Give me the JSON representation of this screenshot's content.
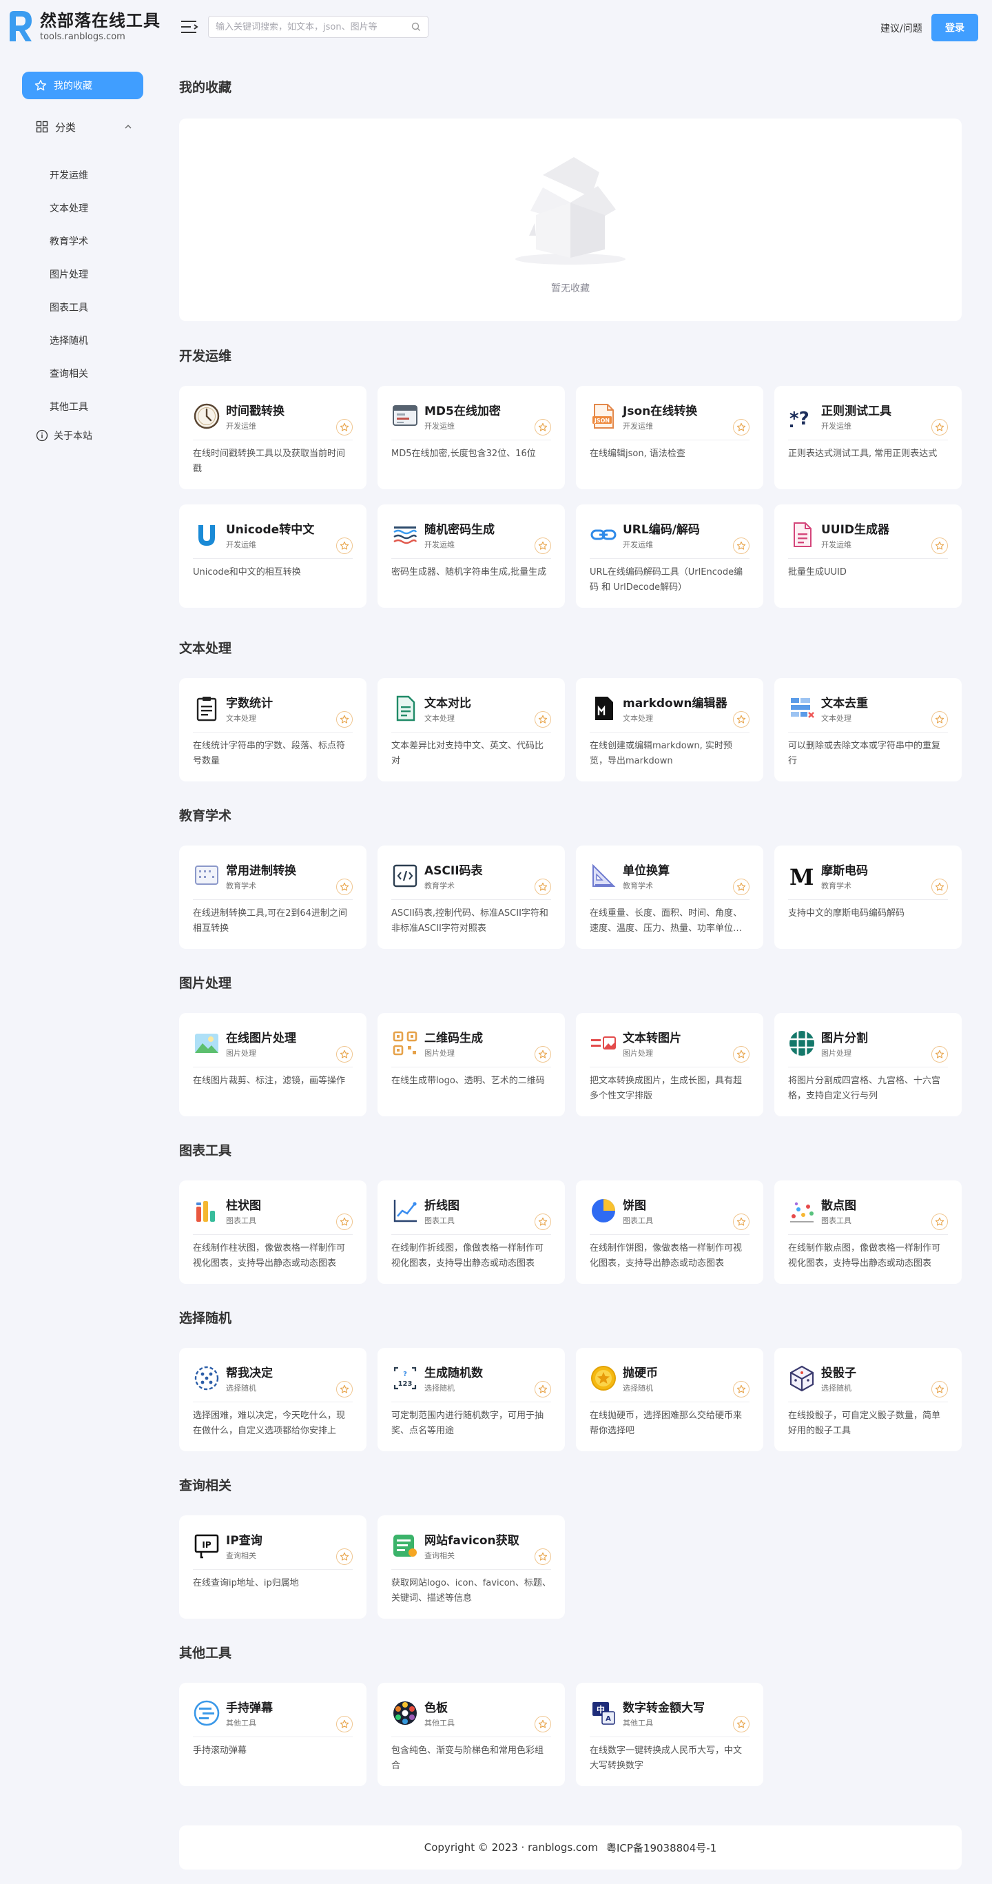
{
  "header": {
    "site_title": "然部落在线工具",
    "site_domain": "tools.ranblogs.com",
    "search_placeholder": "输入关键词搜索，如文本，json、图片等",
    "feedback_label": "建议/问题",
    "login_label": "登录"
  },
  "sidebar": {
    "favorites_label": "我的收藏",
    "category_label": "分类",
    "items": [
      "开发运维",
      "文本处理",
      "教育学术",
      "图片处理",
      "图表工具",
      "选择随机",
      "查询相关",
      "其他工具"
    ],
    "about_label": "关于本站"
  },
  "favorites": {
    "title": "我的收藏",
    "empty_text": "暂无收藏"
  },
  "sections": [
    {
      "title": "开发运维",
      "cards": [
        {
          "title": "时间戳转换",
          "cat": "开发运维",
          "desc": "在线时间戳转换工具以及获取当前时间戳",
          "icon": "clock-icon"
        },
        {
          "title": "MD5在线加密",
          "cat": "开发运维",
          "desc": "MD5在线加密,长度包含32位、16位",
          "icon": "md5-icon"
        },
        {
          "title": "Json在线转换",
          "cat": "开发运维",
          "desc": "在线编辑json, 语法检查",
          "icon": "json-file-icon"
        },
        {
          "title": "正则测试工具",
          "cat": "开发运维",
          "desc": "正则表达式测试工具, 常用正则表达式",
          "icon": "regex-icon"
        },
        {
          "title": "Unicode转中文",
          "cat": "开发运维",
          "desc": "Unicode和中文的相互转换",
          "icon": "unicode-icon"
        },
        {
          "title": "随机密码生成",
          "cat": "开发运维",
          "desc": "密码生成器、随机字符串生成,批量生成",
          "icon": "password-icon"
        },
        {
          "title": "URL编码/解码",
          "cat": "开发运维",
          "desc": "URL在线编码解码工具（UrlEncode编码 和 UrlDecode解码）",
          "icon": "link-icon"
        },
        {
          "title": "UUID生成器",
          "cat": "开发运维",
          "desc": "批量生成UUID",
          "icon": "document-icon"
        }
      ]
    },
    {
      "title": "文本处理",
      "cards": [
        {
          "title": "字数统计",
          "cat": "文本处理",
          "desc": "在线统计字符串的字数、段落、标点符号数量",
          "icon": "clipboard-icon"
        },
        {
          "title": "文本对比",
          "cat": "文本处理",
          "desc": "文本差异比对支持中文、英文、代码比对",
          "icon": "compare-icon"
        },
        {
          "title": "markdown编辑器",
          "cat": "文本处理",
          "desc": "在线创建或编辑markdown, 实时预览，导出markdown",
          "icon": "markdown-icon"
        },
        {
          "title": "文本去重",
          "cat": "文本处理",
          "desc": "可以删除或去除文本或字符串中的重复行",
          "icon": "dedupe-icon"
        }
      ]
    },
    {
      "title": "教育学术",
      "cards": [
        {
          "title": "常用进制转换",
          "cat": "教育学术",
          "desc": "在线进制转换工具,可在2到64进制之间相互转换",
          "icon": "binary-icon"
        },
        {
          "title": "ASCII码表",
          "cat": "教育学术",
          "desc": "ASCII码表,控制代码、标准ASCII字符和非标准ASCII字符对照表",
          "icon": "code-icon"
        },
        {
          "title": "单位换算",
          "cat": "教育学术",
          "desc": "在线重量、长度、面积、时间、角度、速度、温度、压力、热量、功率单位换算",
          "icon": "ruler-icon"
        },
        {
          "title": "摩斯电码",
          "cat": "教育学术",
          "desc": "支持中文的摩斯电码编码解码",
          "icon": "morse-icon"
        }
      ]
    },
    {
      "title": "图片处理",
      "cards": [
        {
          "title": "在线图片处理",
          "cat": "图片处理",
          "desc": "在线图片裁剪、标注，滤镜，画等操作",
          "icon": "image-icon"
        },
        {
          "title": "二维码生成",
          "cat": "图片处理",
          "desc": "在线生成带logo、透明、艺术的二维码",
          "icon": "qrcode-icon"
        },
        {
          "title": "文本转图片",
          "cat": "图片处理",
          "desc": "把文本转换成图片，生成长图，具有超多个性文字排版",
          "icon": "text-image-icon"
        },
        {
          "title": "图片分割",
          "cat": "图片处理",
          "desc": "将图片分割成四宫格、九宫格、十六宫格，支持自定义行与列",
          "icon": "grid-icon"
        }
      ]
    },
    {
      "title": "图表工具",
      "cards": [
        {
          "title": "柱状图",
          "cat": "图表工具",
          "desc": "在线制作柱状图，像做表格一样制作可视化图表，支持导出静态或动态图表",
          "icon": "bar-chart-icon"
        },
        {
          "title": "折线图",
          "cat": "图表工具",
          "desc": "在线制作折线图，像做表格一样制作可视化图表，支持导出静态或动态图表",
          "icon": "line-chart-icon"
        },
        {
          "title": "饼图",
          "cat": "图表工具",
          "desc": "在线制作饼图，像做表格一样制作可视化图表，支持导出静态或动态图表",
          "icon": "pie-chart-icon"
        },
        {
          "title": "散点图",
          "cat": "图表工具",
          "desc": "在线制作散点图，像做表格一样制作可视化图表，支持导出静态或动态图表",
          "icon": "scatter-chart-icon"
        }
      ]
    },
    {
      "title": "选择随机",
      "cards": [
        {
          "title": "帮我决定",
          "cat": "选择随机",
          "desc": "选择困难，难以决定，今天吃什么，现在做什么，自定义选项都给你安排上",
          "icon": "dice-dots-icon"
        },
        {
          "title": "生成随机数",
          "cat": "选择随机",
          "desc": "可定制范围内进行随机数字，可用于抽奖、点名等用途",
          "icon": "random-number-icon"
        },
        {
          "title": "抛硬币",
          "cat": "选择随机",
          "desc": "在线抛硬币，选择困难那么交给硬币来帮你选择吧",
          "icon": "coin-icon"
        },
        {
          "title": "投骰子",
          "cat": "选择随机",
          "desc": "在线投骰子，可自定义骰子数量，简单好用的骰子工具",
          "icon": "cube-icon"
        }
      ]
    },
    {
      "title": "查询相关",
      "cards": [
        {
          "title": "IP查询",
          "cat": "查询相关",
          "desc": "在线查询ip地址、ip归属地",
          "icon": "ip-icon"
        },
        {
          "title": "网站favicon获取",
          "cat": "查询相关",
          "desc": "获取网站logo、icon、favicon、标题、关键词、描述等信息",
          "icon": "favicon-icon"
        }
      ]
    },
    {
      "title": "其他工具",
      "cards": [
        {
          "title": "手持弹幕",
          "cat": "其他工具",
          "desc": "手持滚动弹幕",
          "icon": "barrage-icon"
        },
        {
          "title": "色板",
          "cat": "其他工具",
          "desc": "包含纯色、渐变与阶梯色和常用色彩组合",
          "icon": "palette-icon"
        },
        {
          "title": "数字转金额大写",
          "cat": "其他工具",
          "desc": "在线数字一键转换成人民币大写，中文大写转换数字",
          "icon": "money-icon"
        }
      ]
    }
  ],
  "footer": {
    "copyright": "Copyright © 2023 · ranblogs.com",
    "icp": "粤ICP备19038804号-1"
  }
}
